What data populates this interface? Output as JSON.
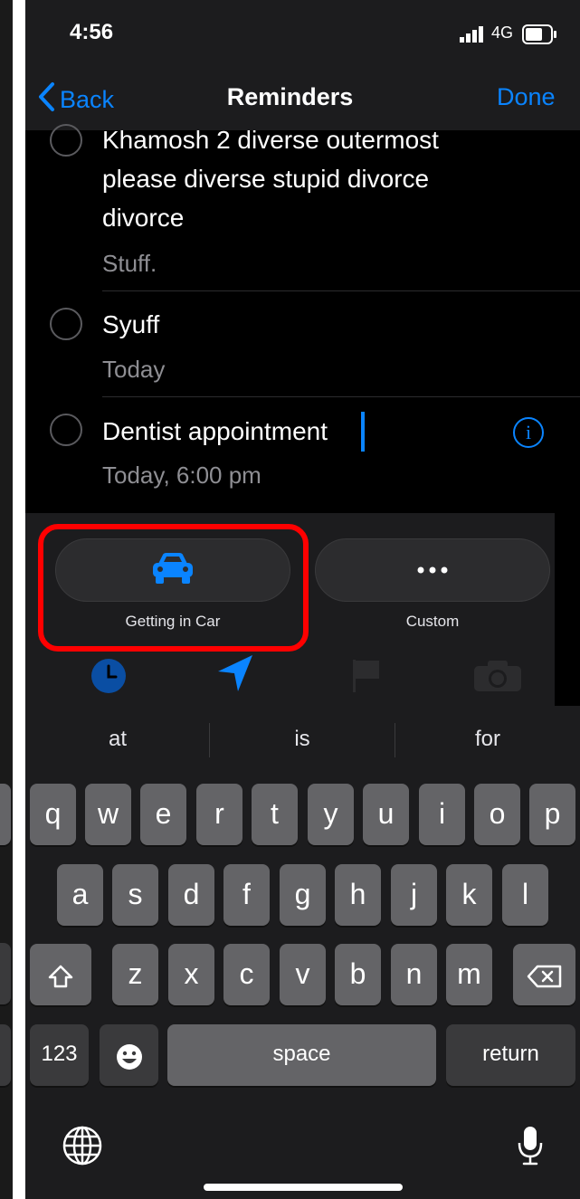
{
  "status": {
    "time": "4:56",
    "network": "4G"
  },
  "nav": {
    "back_label": "Back",
    "title": "Reminders",
    "done_label": "Done"
  },
  "reminders": [
    {
      "title_lines": [
        "Khamosh 2 diverse outermost",
        "please diverse stupid divorce",
        "divorce"
      ],
      "note": "Stuff."
    },
    {
      "title": "Syuff",
      "note": "Today"
    },
    {
      "title": "Dentist appointment",
      "note": "Today, 6:00 pm"
    }
  ],
  "suggestions": [
    {
      "label": "Getting in Car",
      "icon": "car-icon"
    },
    {
      "label": "Custom",
      "icon": "ellipsis-icon"
    }
  ],
  "toolbar_icons": [
    "clock-icon",
    "location-arrow-icon",
    "flag-icon",
    "camera-icon"
  ],
  "predictions": [
    "at",
    "is",
    "for"
  ],
  "keyboard": {
    "row1": [
      "q",
      "w",
      "e",
      "r",
      "t",
      "y",
      "u",
      "i",
      "o",
      "p"
    ],
    "row2": [
      "a",
      "s",
      "d",
      "f",
      "g",
      "h",
      "j",
      "k",
      "l"
    ],
    "row3": [
      "z",
      "x",
      "c",
      "v",
      "b",
      "n",
      "m"
    ],
    "numbers_label": "123",
    "space_label": "space",
    "return_label": "return"
  },
  "colors": {
    "accent": "#0a84ff",
    "highlight": "#ff0000"
  }
}
